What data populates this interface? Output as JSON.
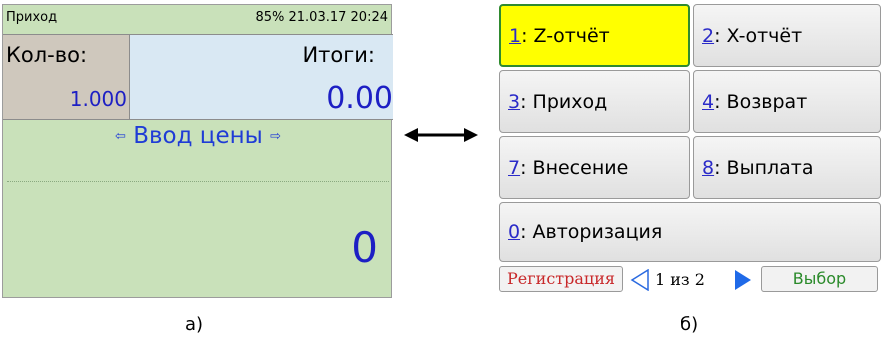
{
  "screen_a": {
    "status_mode": "Приход",
    "status_info": "85% 21.03.17 20:24",
    "qty_label": "Кол-во:",
    "qty_value": "1.000",
    "total_label": "Итоги:",
    "total_value": "0.00",
    "price_prompt": "Ввод цены",
    "price_arrow_left": "⇦",
    "price_arrow_right": "⇨",
    "entry_value": "0",
    "caption": "а)"
  },
  "screen_b": {
    "buttons": [
      {
        "key": "1",
        "label": ": Z-отчёт"
      },
      {
        "key": "2",
        "label": ": X-отчёт"
      },
      {
        "key": "3",
        "label": ": Приход"
      },
      {
        "key": "4",
        "label": ": Возврат"
      },
      {
        "key": "7",
        "label": ": Внесение"
      },
      {
        "key": "8",
        "label": ": Выплата"
      },
      {
        "key": "0",
        "label": ": Авторизация"
      }
    ],
    "selected_color": "#ffff00",
    "registration_label": "Регистрация",
    "page_indicator": "1 из 2",
    "choose_label": "Выбор",
    "caption": "б)"
  }
}
